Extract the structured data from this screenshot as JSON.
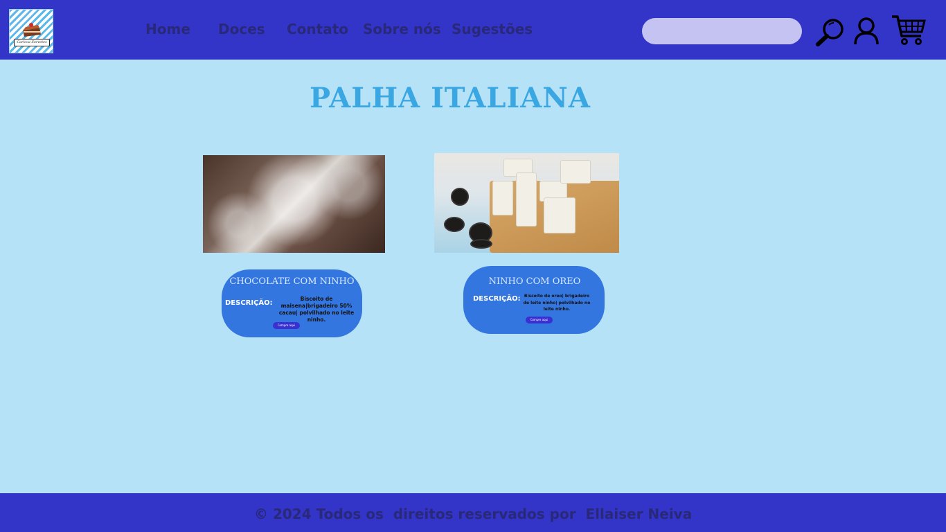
{
  "header": {
    "logo_text": "Carioca Sorvetes",
    "nav": [
      "Home",
      "Doces",
      "Contato",
      "Sobre nós",
      "Sugestões"
    ],
    "search_placeholder": "",
    "icons": [
      "search-icon",
      "user-icon",
      "cart-icon"
    ]
  },
  "main": {
    "title": "PALHA ITALIANA",
    "products": [
      {
        "name": "CHOCOLATE COM NINHO",
        "desc_label": "DESCRIÇÃO:",
        "description": "Biscoito de maisena|brigadeiro 50% cacau| polvilhado no leite ninho.",
        "button": "Compre aqui"
      },
      {
        "name": "NINHO COM OREO",
        "desc_label": "DESCRIÇÃO:",
        "description": "Biscoito de oreo| brigadeiro de leite ninho| polvilhado no leite ninho.",
        "button": "Compre aqui"
      }
    ]
  },
  "footer": {
    "text": "© 2024 Todos os  direitos reservados por  Ellaiser Neiva"
  },
  "colors": {
    "header_bg": "#3235c8",
    "page_bg": "#b6e2f8",
    "title": "#3aa7e2",
    "card_bg": "#3476e0",
    "button_bg": "#3a2fd0",
    "nav_text": "#2a2878"
  }
}
